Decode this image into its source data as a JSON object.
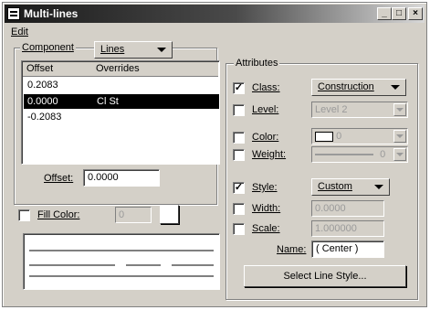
{
  "window": {
    "title": "Multi-lines",
    "min_label": "_",
    "max_label": "□",
    "close_label": "×"
  },
  "menu": {
    "edit": "Edit"
  },
  "component": {
    "label": "Component",
    "type_value": "Lines",
    "columns": [
      "Offset",
      "Overrides"
    ],
    "rows": [
      {
        "offset": "0.2083",
        "overrides": "",
        "selected": false
      },
      {
        "offset": "0.0000",
        "overrides": "Cl St",
        "selected": true
      },
      {
        "offset": "-0.2083",
        "overrides": "",
        "selected": false
      }
    ],
    "offset_label": "Offset:",
    "offset_value": "0.0000"
  },
  "fill": {
    "label": "Fill Color:",
    "value": "0",
    "checked": false
  },
  "attributes": {
    "group_label": "Attributes",
    "class": {
      "label": "Class:",
      "value": "Construction",
      "checked": true
    },
    "level": {
      "label": "Level:",
      "value": "Level 2",
      "checked": false
    },
    "color": {
      "label": "Color:",
      "value": "0",
      "checked": false
    },
    "weight": {
      "label": "Weight:",
      "value": "0",
      "checked": false
    },
    "style": {
      "label": "Style:",
      "value": "Custom",
      "checked": true
    },
    "width": {
      "label": "Width:",
      "value": "0.0000",
      "checked": false
    },
    "scale": {
      "label": "Scale:",
      "value": "1.000000",
      "checked": false
    },
    "name": {
      "label": "Name:",
      "value": "( Center )"
    },
    "select_style_button": "Select Line Style..."
  },
  "check_mark": "✓"
}
